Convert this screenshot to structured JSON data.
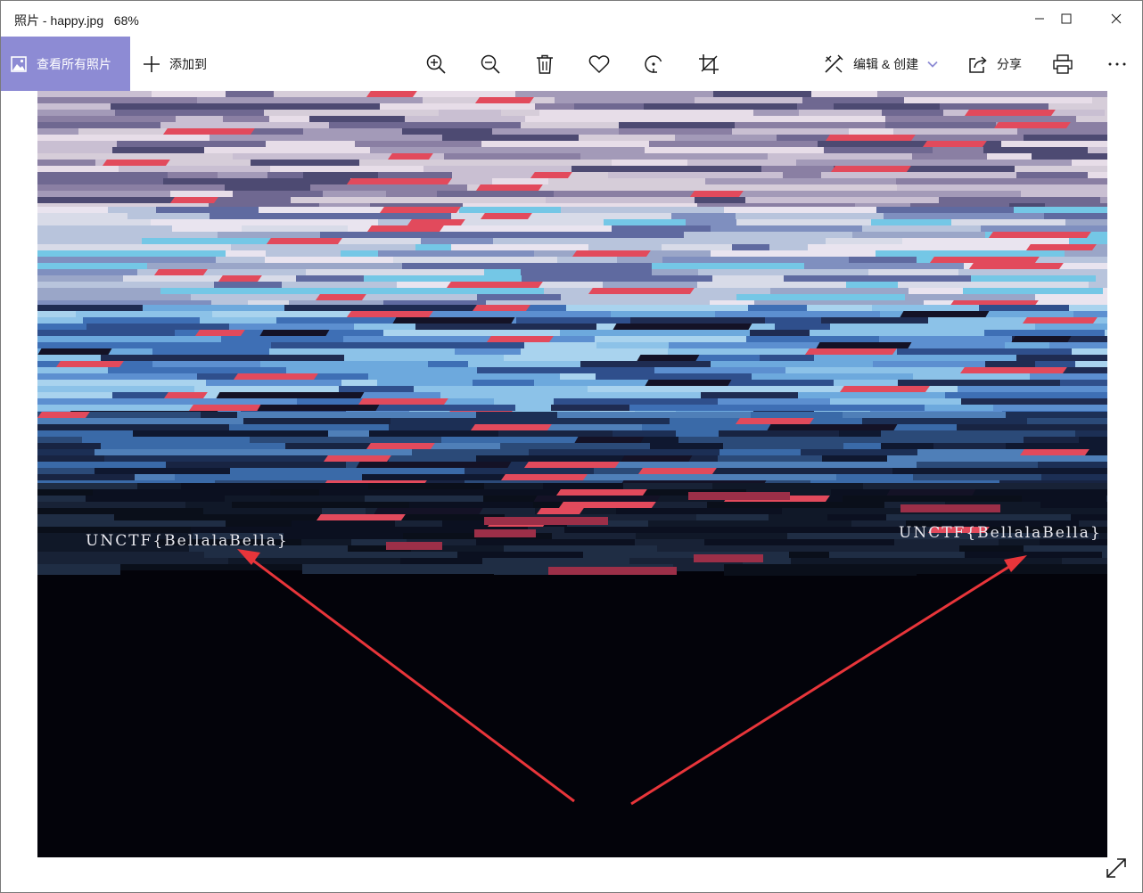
{
  "window": {
    "title": "照片 - happy.jpg   68%"
  },
  "toolbar": {
    "view_all_label": "查看所有照片",
    "add_to_label": "添加到",
    "edit_create_label": "编辑 & 创建",
    "share_label": "分享"
  },
  "photo": {
    "flag_text_left": "UNCTF{BellalaBella}",
    "flag_text_right": "UNCTF{BellalaBella}"
  },
  "icons": {
    "view_all": "photos-icon",
    "add_to": "plus-icon",
    "zoom_in": "zoom-in-icon",
    "zoom_out": "zoom-out-icon",
    "delete": "trash-icon",
    "favorite": "heart-icon",
    "rotate": "rotate-icon",
    "crop": "crop-icon",
    "edit": "edit-create-icon",
    "share": "share-icon",
    "print": "printer-icon",
    "more": "more-icon",
    "fullscreen": "expand-icon"
  },
  "colors": {
    "accent": "#8d8bd4",
    "annotation_arrow": "#e8353a",
    "photo_background": "#03030a"
  }
}
